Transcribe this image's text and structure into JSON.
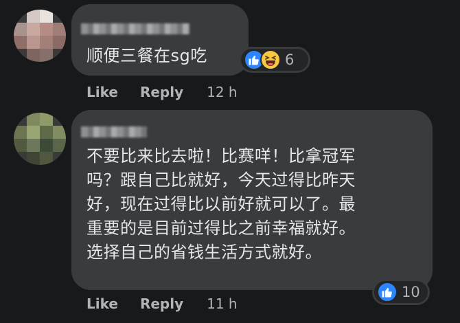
{
  "comments": [
    {
      "text": "顺便三餐在sg吃",
      "reactions": {
        "icons": [
          "like-icon",
          "haha-icon"
        ],
        "count": "6"
      },
      "actions": {
        "like": "Like",
        "reply": "Reply",
        "time": "12 h"
      }
    },
    {
      "text": "不要比来比去啦！比赛咩！比拿冠军\n吗？跟自己比就好，今天过得比昨天\n好，现在过得比以前好就可以了。最\n重要的是目前过得比之前幸福就好。\n选择自己的省钱生活方式就好。",
      "reactions": {
        "icons": [
          "like-icon"
        ],
        "count": "10"
      },
      "actions": {
        "like": "Like",
        "reply": "Reply",
        "time": "11 h"
      }
    }
  ],
  "colors": {
    "background": "#18191a",
    "bubble": "#3a3b3c",
    "text": "#e4e6eb",
    "secondary_text": "#b0b3b8",
    "like_blue": "#2d86ff",
    "haha_yellow": "#f7c844"
  }
}
